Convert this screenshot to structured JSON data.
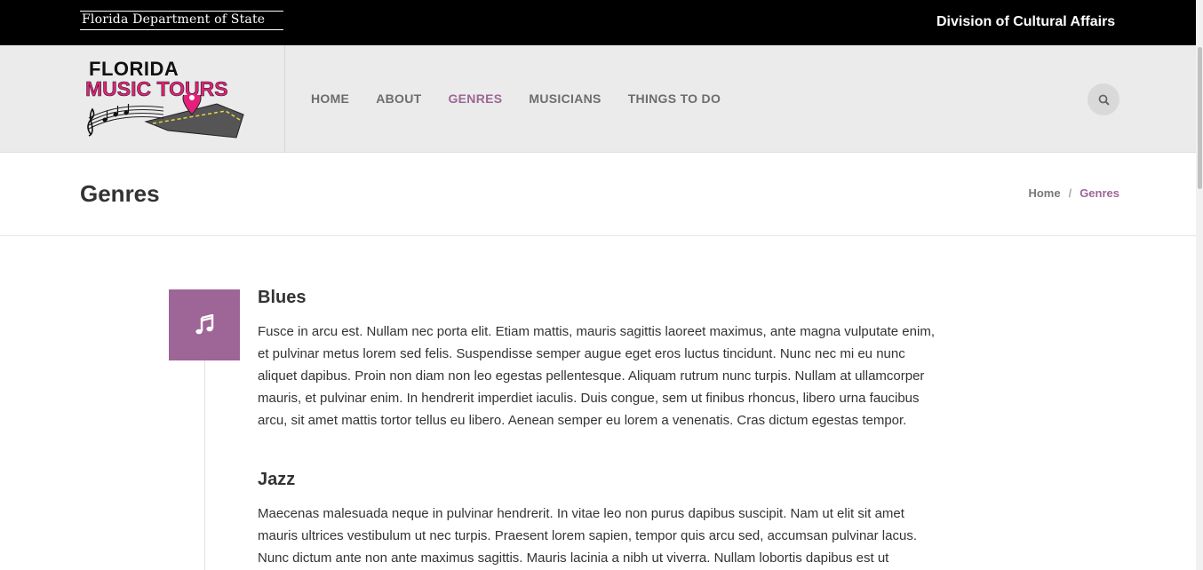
{
  "topbar": {
    "agency_logo_text": "Florida Department of State",
    "division": "Division of Cultural Affairs"
  },
  "logo": {
    "line1": "FLORIDA",
    "line2": "MUSIC TOURS"
  },
  "nav": {
    "items": [
      {
        "label": "HOME",
        "active": false
      },
      {
        "label": "ABOUT",
        "active": false
      },
      {
        "label": "GENRES",
        "active": true
      },
      {
        "label": "MUSICIANS",
        "active": false
      },
      {
        "label": "THINGS TO DO",
        "active": false
      }
    ],
    "search_icon": "search-icon"
  },
  "page": {
    "title": "Genres",
    "breadcrumb": {
      "home": "Home",
      "separator": "/",
      "current": "Genres"
    }
  },
  "genres": [
    {
      "title": "Blues",
      "icon": "music-note-icon",
      "text": "Fusce in arcu est. Nullam nec porta elit. Etiam mattis, mauris sagittis laoreet maximus, ante magna vulputate enim, et pulvinar metus lorem sed felis. Suspendisse semper augue eget eros luctus tincidunt. Nunc nec mi eu nunc aliquet dapibus. Proin non diam non leo egestas pellentesque. Aliquam rutrum nunc turpis. Nullam at ullamcorper mauris, et pulvinar enim. In hendrerit imperdiet iaculis. Duis congue, sem ut finibus rhoncus, libero urna faucibus arcu, sit amet mattis tortor tellus eu libero. Aenean semper eu lorem a venenatis. Cras dictum egestas tempor."
    },
    {
      "title": "Jazz",
      "text": "Maecenas malesuada neque in pulvinar hendrerit. In vitae leo non purus dapibus suscipit. Nam ut elit sit amet mauris ultrices vestibulum ut nec turpis. Praesent lorem sapien, tempor quis arcu sed, accumsan pulvinar lacus. Nunc dictum ante non ante maximus sagittis. Mauris lacinia a nibh ut viverra. Nullam lobortis dapibus est ut"
    }
  ],
  "colors": {
    "accent": "#9d6697",
    "topbar": "#000000",
    "header_bg": "#ebebeb",
    "logo_pink": "#e5207a"
  }
}
